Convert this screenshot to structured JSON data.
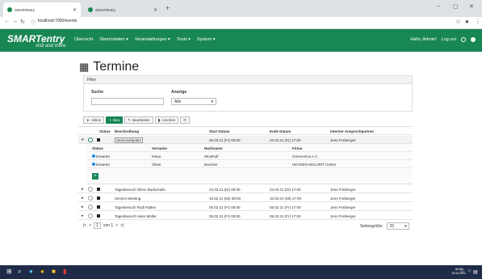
{
  "browser": {
    "tabs": [
      {
        "title": "SMARTentry"
      },
      {
        "title": "SMARTentry"
      }
    ],
    "url": "localhost:7000/events",
    "new_tab": "+",
    "controls": {
      "minimize": "–",
      "maximize": "▢",
      "close": "✕"
    }
  },
  "navbar": {
    "brand": "SMARTentry",
    "brand_sub": "visit and more",
    "links": [
      "Übersicht",
      "Stammdaten ▾",
      "Veranstaltungen ▾",
      "Tools ▾",
      "System ▾"
    ],
    "greeting": "Hallo, Admin!",
    "logout": "Log out"
  },
  "page": {
    "title": "Termine"
  },
  "filter": {
    "header": "Filter",
    "search_label": "Suche",
    "search_value": "",
    "display_label": "Anzeige",
    "display_value": "Alle"
  },
  "toolbar": {
    "action": "Aktion",
    "new": "Neu",
    "edit": "Bearbeiten",
    "delete": "Löschen",
    "refresh": "⟳"
  },
  "table": {
    "headers": [
      "Status",
      "Beschreibung",
      "Start Datum",
      "Ende Datum",
      "Interner Ansprechpartner"
    ],
    "rows": [
      {
        "desc": "Serviceartjeiten",
        "start": "26.03.21 (Fr) 08:00",
        "end": "26.03.21 (Fr) 17:00",
        "contact": "Jens Freiberger"
      },
      {
        "desc": "Tagesbesuch Oliver Budschulla",
        "start": "23.03.21 (Di) 08:00",
        "end": "23.03.21 (Di) 17:00",
        "contact": "Jens Freiberger"
      },
      {
        "desc": "Service Meeting",
        "start": "10.02.21 (Mi) 08:00",
        "end": "10.02.21 (Mi) 17:00",
        "contact": "Jens Freiberger"
      },
      {
        "desc": "Tagesbesuch Rudi Raltes",
        "start": "05.02.21 (Fr) 08:00",
        "end": "05.02.21 (Fr) 17:00",
        "contact": "Jens Freiberger"
      },
      {
        "desc": "Tagesbesuch Hans Müller",
        "start": "05.02.21 (Fr) 08:00",
        "end": "05.02.21 (Fr) 17:00",
        "contact": "Jens Freiberger"
      }
    ]
  },
  "detail": {
    "headers": [
      "Status",
      "Vorname",
      "Nachname",
      "Firma"
    ],
    "rows": [
      {
        "status": "Erwartet",
        "first": "Klaus",
        "last": "Wustholf",
        "company": "Grenzenlos e.V."
      },
      {
        "status": "Erwartet",
        "first": "Oliver",
        "last": "Boscher",
        "company": "HEYDEN-SECURIT GmbH"
      }
    ],
    "add": "+"
  },
  "pager": {
    "first": "|<",
    "prev": "<",
    "page": "1",
    "of": "von 1",
    "next": ">",
    "last": ">|",
    "size_label": "Seitengröße:",
    "size_value": "20"
  },
  "taskbar": {
    "time": "15:09",
    "date": "25.03.2021"
  }
}
